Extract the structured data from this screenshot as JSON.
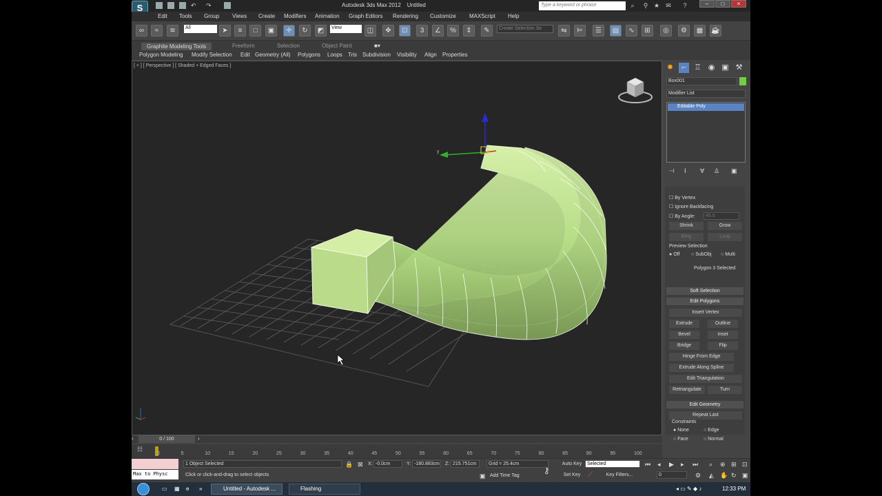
{
  "window": {
    "app_title": "Autodesk 3ds Max 2012",
    "doc_title": "Untitled",
    "search_placeholder": "Type a keyword or phrase"
  },
  "menu": [
    "Edit",
    "Tools",
    "Group",
    "Views",
    "Create",
    "Modifiers",
    "Animation",
    "Graph Editors",
    "Rendering",
    "Customize",
    "MAXScript",
    "Help"
  ],
  "toolbar": {
    "filter_value": "All",
    "refcoord_value": "View",
    "selection_set_placeholder": "Create Selection Se"
  },
  "ribbon": {
    "tabs": [
      "Graphite Modeling Tools",
      "Freeform",
      "Selection",
      "Object Paint"
    ],
    "subtabs": [
      "Polygon Modeling",
      "Modify Selection",
      "Edit",
      "Geometry (All)",
      "Polygons",
      "Loops",
      "Tris",
      "Subdivision",
      "Visibility",
      "Align",
      "Properties"
    ]
  },
  "viewport": {
    "label": "[ + ] [ Perspective ] [ Shaded + Edged Faces ]",
    "axis_y": "y"
  },
  "command_panel": {
    "object_name": "Box001",
    "modifier_list": "Modifier List",
    "stack_item": "Editable Poly",
    "by_vertex": "By Vertex",
    "ignore_backfacing": "Ignore Backfacing",
    "by_angle": "By Angle:",
    "by_angle_value": "45.0",
    "shrink": "Shrink",
    "grow": "Grow",
    "ring": "Ring",
    "loop": "Loop",
    "preview_selection": "Preview Selection",
    "preview_off": "Off",
    "preview_subobj": "SubObj",
    "preview_multi": "Multi",
    "selection_status": "Polygon 3 Selected",
    "soft_selection": "Soft Selection",
    "edit_polygons": "Edit Polygons",
    "insert_vertex": "Insert Vertex",
    "extrude": "Extrude",
    "outline": "Outline",
    "bevel": "Bevel",
    "inset": "Inset",
    "bridge": "Bridge",
    "flip": "Flip",
    "hinge": "Hinge From Edge",
    "extrude_spline": "Extrude Along Spline",
    "edit_triangulation": "Edit Triangulation",
    "retriangulate": "Retriangulate",
    "turn": "Turn",
    "edit_geometry": "Edit Geometry",
    "repeat_last": "Repeat Last",
    "constraints": "Constraints",
    "c_none": "None",
    "c_edge": "Edge",
    "c_face": "Face",
    "c_normal": "Normal"
  },
  "timeline": {
    "frame": "0 / 100",
    "ticks": [
      "0",
      "5",
      "10",
      "15",
      "20",
      "25",
      "30",
      "35",
      "40",
      "45",
      "50",
      "55",
      "60",
      "65",
      "70",
      "75",
      "80",
      "85",
      "90",
      "95",
      "100"
    ]
  },
  "status": {
    "listener": "Max to Physc",
    "selected": "1 Object Selected",
    "prompt": "Click or click-and-drag to select objects",
    "x_label": "X:",
    "x_value": "-0.0cm",
    "y_label": "Y:",
    "y_value": "-180.883cm",
    "z_label": "Z:",
    "z_value": "215.751cm",
    "grid": "Grid = 25.4cm",
    "add_time_tag": "Add Time Tag",
    "auto_key": "Auto Key",
    "set_key": "Set Key",
    "key_mode": "Selected",
    "key_filters": "Key Filters...",
    "current_frame": "0"
  },
  "taskbar": {
    "item1": "Untitled - Autodesk ...",
    "item2": "Flashing",
    "clock": "12:33 PM"
  },
  "colors": {
    "object": "#c8e8a0",
    "accent": "#5a83c4",
    "object_color_swatch": "#6fcf3f"
  }
}
